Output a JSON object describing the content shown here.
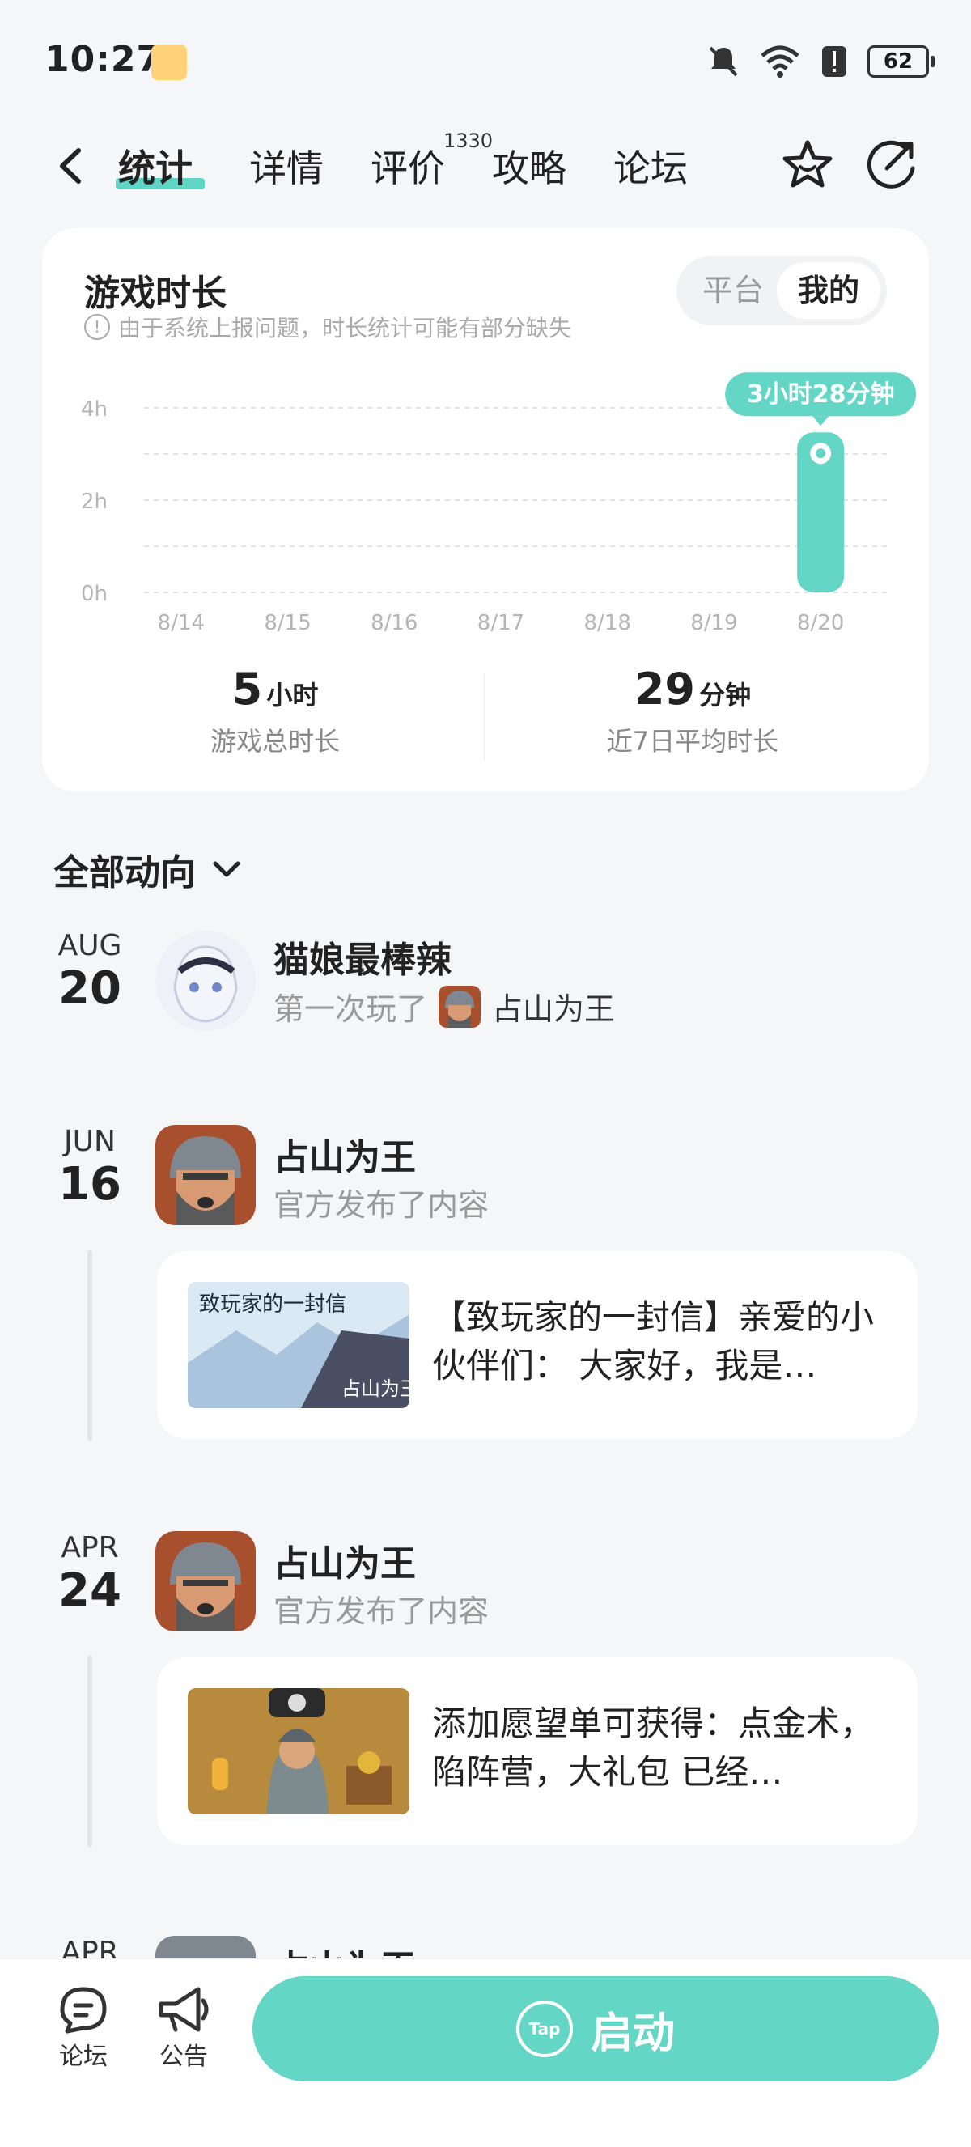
{
  "status_bar": {
    "time": "10:27",
    "battery": "62"
  },
  "nav": {
    "tabs": [
      {
        "label": "统计",
        "active": true
      },
      {
        "label": "详情",
        "active": false
      },
      {
        "label": "评价",
        "active": false
      },
      {
        "label": "攻略",
        "active": false
      },
      {
        "label": "论坛",
        "active": false
      }
    ],
    "review_count": "1330"
  },
  "stats_card": {
    "title": "游戏时长",
    "note": "由于系统上报问题，时长统计可能有部分缺失",
    "toggle": {
      "options": [
        "平台",
        "我的"
      ],
      "selected": "我的"
    },
    "summary": [
      {
        "value": "5",
        "unit": "小时",
        "label": "游戏总时长"
      },
      {
        "value": "29",
        "unit": "分钟",
        "label": "近7日平均时长"
      }
    ]
  },
  "chart_data": {
    "type": "bar",
    "categories": [
      "8/14",
      "8/15",
      "8/16",
      "8/17",
      "8/18",
      "8/19",
      "8/20"
    ],
    "values": [
      0,
      0,
      0,
      0,
      0,
      0,
      3.47
    ],
    "ytick_labels": [
      "0h",
      "2h",
      "4h"
    ],
    "ylim": [
      0,
      4
    ],
    "annotation": "3小时28分钟",
    "bar_color": "#63d6c5",
    "grid": true
  },
  "feed": {
    "section_title": "全部动向",
    "items": [
      {
        "month": "AUG",
        "day": "20",
        "title": "猫娘最棒辣",
        "sub_prefix": "第一次玩了",
        "sub_game": "占山为王"
      },
      {
        "month": "JUN",
        "day": "16",
        "title": "占山为王",
        "sub": "官方发布了内容",
        "post_text": "【致玩家的一封信】亲爱的小伙伴们： 大家好，我是…",
        "thumb_caption": "致玩家的一封信",
        "thumb_stamp": "占山为王"
      },
      {
        "month": "APR",
        "day": "24",
        "title": "占山为王",
        "sub": "官方发布了内容",
        "post_text": "添加愿望单可获得：点金术，陷阵营，大礼包 已经…"
      },
      {
        "month": "APR",
        "day": "",
        "title": "占山为王"
      }
    ]
  },
  "bottom_bar": {
    "forum_label": "论坛",
    "notice_label": "公告",
    "launch_label": "启动",
    "tap_logo_text": "Tap"
  },
  "colors": {
    "accent": "#63d6c5"
  }
}
